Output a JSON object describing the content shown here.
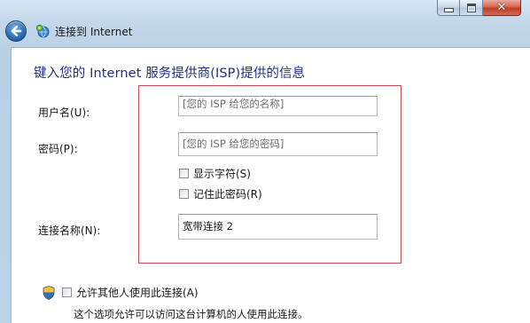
{
  "window": {
    "title": "连接到 Internet",
    "caption_buttons": [
      "minimize",
      "maximize",
      "close"
    ]
  },
  "page": {
    "heading": "键入您的 Internet 服务提供商(ISP)提供的信息"
  },
  "fields": {
    "username": {
      "label": "用户名(U):",
      "value": "[您的 ISP 给您的名称]"
    },
    "password": {
      "label": "密码(P):",
      "value": "[您的 ISP 给您的密码]"
    },
    "show_chars": {
      "label": "显示字符(S)",
      "checked": false
    },
    "remember_password": {
      "label": "记住此密码(R)",
      "checked": false
    },
    "connection_name": {
      "label": "连接名称(N):",
      "value": "宽带连接 2"
    }
  },
  "sharing": {
    "allow_others_label": "允许其他人使用此连接(A)",
    "allow_others_checked": false,
    "note": "这个选项允许可以访问这台计算机的人使用此连接。"
  },
  "icons": {
    "back": "back-arrow-icon",
    "network": "network-globe-icon",
    "shield": "uac-shield-icon"
  },
  "colors": {
    "heading": "#1e3287",
    "highlight_frame": "#c94a4a",
    "window_frame": "#c4d9ea",
    "close_button": "#c0391f"
  }
}
